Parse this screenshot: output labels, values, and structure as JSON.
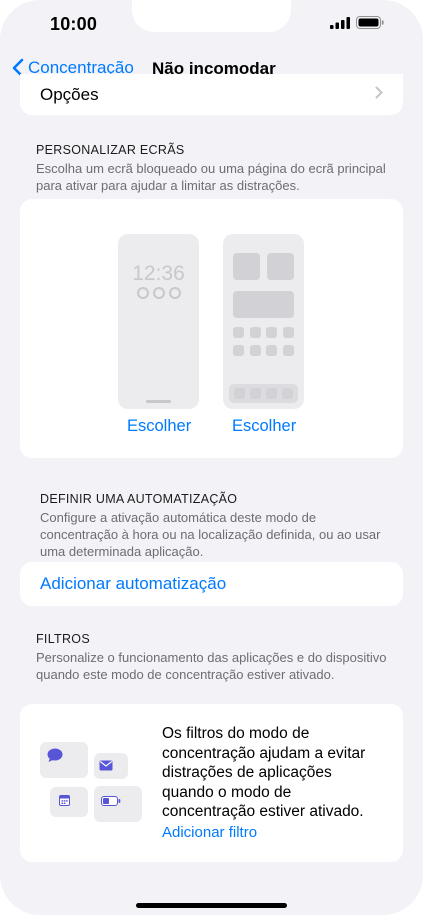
{
  "status_bar": {
    "time": "10:00"
  },
  "nav": {
    "back_label": "Concentração",
    "title": "Não incomodar"
  },
  "options_row": {
    "label": "Opções"
  },
  "customize_screens": {
    "header": "PERSONALIZAR ECRÃS",
    "description": "Escolha um ecrã bloqueado ou uma página do ecrã principal para ativar para ajudar a limitar as distrações.",
    "lock_preview_time": "12:36",
    "lock_choose_label": "Escolher",
    "home_choose_label": "Escolher"
  },
  "automation": {
    "header": "DEFINIR UMA AUTOMATIZAÇÃO",
    "description": "Configure a ativação automática deste modo de concentração à hora ou na localização definida, ou ao usar uma determinada aplicação.",
    "add_label": "Adicionar automatização"
  },
  "filters": {
    "header": "FILTROS",
    "description": "Personalize o funcionamento das aplicações e do dispositivo quando este modo de concentração estiver ativado.",
    "card_text": "Os filtros do modo de concentração ajudam a evitar distrações de aplicações quando o modo de concentração estiver ativado.",
    "add_label": "Adicionar filtro",
    "icons": [
      "message-icon",
      "mail-icon",
      "calendar-icon",
      "battery-icon"
    ]
  },
  "colors": {
    "accent": "#007aff",
    "filter_icon": "#5856d6",
    "background": "#f2f2f7"
  }
}
